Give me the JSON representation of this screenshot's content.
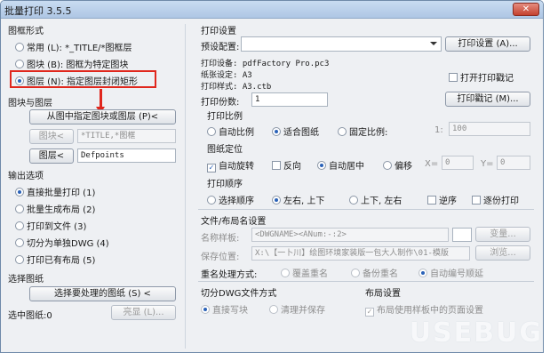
{
  "window": {
    "title": "批量打印 3.5.5",
    "close_label": "✕"
  },
  "left": {
    "frame_form": {
      "title": "图框形式",
      "options": [
        {
          "label": "常用 (L): *_TITLE/*图框层",
          "selected": false
        },
        {
          "label": "图块 (B): 图框为特定图块",
          "selected": false
        },
        {
          "label": "图层 (N): 指定图层封闭矩形",
          "selected": true
        }
      ]
    },
    "blocks_layers": {
      "title": "图块与图层",
      "pick_button": "从图中指定图块或图层 (P)<",
      "block_button": "图块<",
      "block_value": "*TITLE,*图框",
      "layer_button": "图层<",
      "layer_value": "Defpoints"
    },
    "output": {
      "title": "输出选项",
      "options": [
        {
          "label": "直接批量打印 (1)",
          "selected": true
        },
        {
          "label": "批量生成布局 (2)",
          "selected": false
        },
        {
          "label": "打印到文件 (3)",
          "selected": false
        },
        {
          "label": "切分为单独DWG (4)",
          "selected": false
        },
        {
          "label": "打印已有布局 (5)",
          "selected": false
        }
      ]
    },
    "select": {
      "title": "选择图纸",
      "button": "选择要处理的图纸 (S) <",
      "count_label": "选中图纸:0",
      "highlight_button": "亮显 (L)..."
    }
  },
  "right": {
    "print_settings": {
      "title": "打印设置",
      "preset_label": "预设配置:",
      "preset_value": "",
      "settings_button": "打印设置 (A)...",
      "device": "打印设备: pdfFactory Pro.pc3",
      "paper": "纸张设定: A3",
      "style": "打印样式: A3.ctb",
      "open_stamp_label": "打开打印戳记",
      "open_stamp_checked": false,
      "copies_label": "打印份数:",
      "copies_value": "1",
      "stamp_button": "打印戳记 (M)..."
    },
    "scale": {
      "title": "打印比例",
      "options": [
        {
          "label": "自动比例",
          "selected": false
        },
        {
          "label": "适合图纸",
          "selected": true
        },
        {
          "label": "固定比例:",
          "selected": false
        }
      ],
      "ratio_prefix": "1:",
      "ratio_value": "100"
    },
    "position": {
      "title": "图纸定位",
      "auto_rotate": "自动旋转",
      "auto_rotate_checked": true,
      "reverse": "反向",
      "reverse_checked": false,
      "options": [
        {
          "label": "自动居中",
          "selected": true
        },
        {
          "label": "偏移",
          "selected": false
        }
      ],
      "x_label": "X=",
      "x_value": "0",
      "y_label": "Y=",
      "y_value": "0"
    },
    "order": {
      "title": "打印顺序",
      "options": [
        {
          "label": "选择顺序",
          "selected": false
        },
        {
          "label": "左右, 上下",
          "selected": true
        },
        {
          "label": "上下, 左右",
          "selected": false
        }
      ],
      "reverse": "逆序",
      "reverse_checked": false,
      "page_by_page": "逐份打印",
      "page_by_page_checked": false
    },
    "file_layout": {
      "title": "文件/布局名设置",
      "name_template_label": "名称样板:",
      "name_template_value": "<DWGNAME><ANum:-:2>",
      "change_button": "变量...",
      "save_location_label": "保存位置:",
      "save_location_value": "X:\\【一卜川】绘图环境家装版一包大人制作\\01-模版",
      "browse_button": "浏览...",
      "rename_label": "重名处理方式:",
      "rename_options": [
        {
          "label": "覆盖重名",
          "selected": false
        },
        {
          "label": "备份重名",
          "selected": false
        },
        {
          "label": "自动编号顺延",
          "selected": true
        }
      ]
    },
    "split": {
      "title": "切分DWG文件方式",
      "options": [
        {
          "label": "直接写块",
          "selected": true
        },
        {
          "label": "清理并保存",
          "selected": false
        }
      ]
    },
    "layout": {
      "title": "布局设置",
      "use_template": "布局使用样板中的页面设置",
      "use_template_checked": true
    }
  },
  "watermark": "USEBUG"
}
